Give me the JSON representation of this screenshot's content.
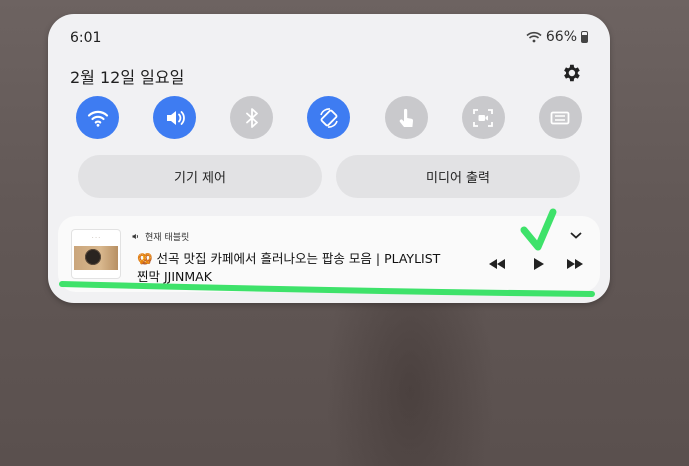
{
  "status_bar": {
    "time": "6:01",
    "battery": "66%"
  },
  "header": {
    "date": "2월 12일 일요일"
  },
  "quick_toggles": [
    {
      "name": "wifi",
      "icon": "wifi-icon",
      "active": true
    },
    {
      "name": "sound",
      "icon": "speaker-icon",
      "active": true
    },
    {
      "name": "bluetooth",
      "icon": "bluetooth-icon",
      "active": false
    },
    {
      "name": "auto-rotate",
      "icon": "rotate-icon",
      "active": true
    },
    {
      "name": "touch",
      "icon": "touch-icon",
      "active": false
    },
    {
      "name": "screen-recorder",
      "icon": "screen-record-icon",
      "active": false
    },
    {
      "name": "keyboard",
      "icon": "keyboard-icon",
      "active": false
    }
  ],
  "buttons": {
    "device_control": "기기 제어",
    "media_output": "미디어 출력"
  },
  "media": {
    "device_label": "현재 태블릿",
    "title": "🥨 선곡 맛집 카페에서 흘러나오는 팝송 모음 | PLAYLIST",
    "artist": "찐막 JJINMAK"
  },
  "colors": {
    "accent": "#3e7cf2",
    "toggle_off": "#c9c9cc",
    "annotation": "#3ee26a"
  }
}
